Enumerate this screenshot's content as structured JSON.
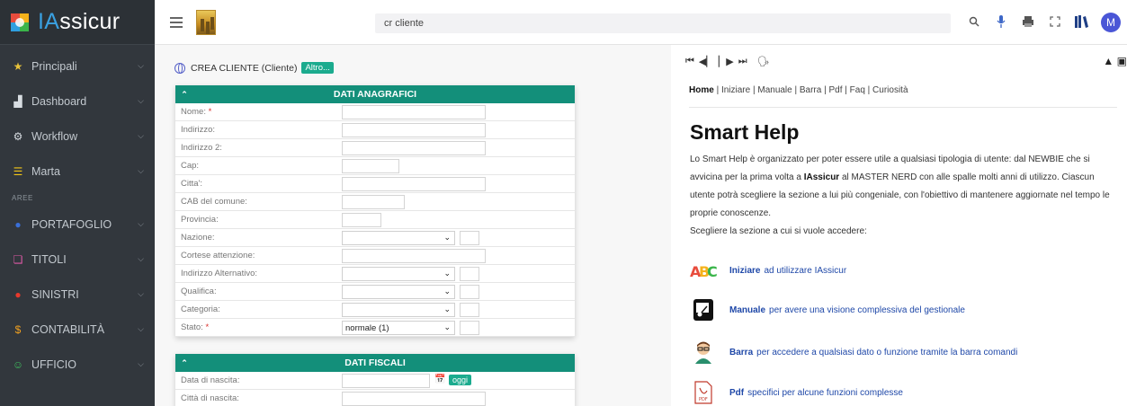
{
  "brand": {
    "name_prefix": "IA",
    "name_rest": "ssicur"
  },
  "sidebar": {
    "items": [
      {
        "label": "Principali",
        "icon": "star-icon",
        "glyph": "★",
        "color": "#e8c23a"
      },
      {
        "label": "Dashboard",
        "icon": "bar-chart-icon",
        "glyph": "▟",
        "color": "#d8dde2"
      },
      {
        "label": "Workflow",
        "icon": "gear-icon",
        "glyph": "⚙",
        "color": "#d8dde2"
      },
      {
        "label": "Marta",
        "icon": "list-icon",
        "glyph": "☰",
        "color": "#f0c419"
      }
    ],
    "section_label": "AREE",
    "area_items": [
      {
        "label": "PORTAFOGLIO",
        "icon": "globe-icon",
        "glyph": "●",
        "color": "#3a6fd8"
      },
      {
        "label": "TITOLI",
        "icon": "documents-icon",
        "glyph": "❏",
        "color": "#e05aa8"
      },
      {
        "label": "SINISTRI",
        "icon": "alert-icon",
        "glyph": "●",
        "color": "#e8392c"
      },
      {
        "label": "CONTABILITÀ",
        "icon": "dollar-icon",
        "glyph": "$",
        "color": "#f0a020"
      },
      {
        "label": "UFFICIO",
        "icon": "smile-icon",
        "glyph": "☺",
        "color": "#3fbf5f"
      }
    ]
  },
  "topbar": {
    "search_value": "cr cliente",
    "icons": [
      "search-icon",
      "microphone-icon",
      "print-icon",
      "fullscreen-icon",
      "book-icon"
    ],
    "avatar_initial": "M"
  },
  "form": {
    "breadcrumb": "CREA CLIENTE (Cliente)",
    "altro_label": "Altro...",
    "anagrafici": {
      "title": "DATI ANAGRAFICI",
      "rows": [
        {
          "label": "Nome:",
          "required": "*",
          "type": "input",
          "w": 160
        },
        {
          "label": "Indirizzo:",
          "required": "",
          "type": "input",
          "w": 160
        },
        {
          "label": "Indirizzo 2:",
          "required": "",
          "type": "input",
          "w": 160
        },
        {
          "label": "Cap:",
          "required": "",
          "type": "input",
          "w": 64
        },
        {
          "label": "Citta':",
          "required": "",
          "type": "input",
          "w": 160
        },
        {
          "label": "CAB del comune:",
          "required": "",
          "type": "input",
          "w": 70
        },
        {
          "label": "Provincia:",
          "required": "",
          "type": "input",
          "w": 44
        },
        {
          "label": "Nazione:",
          "required": "",
          "type": "select",
          "value": ""
        },
        {
          "label": "Cortese attenzione:",
          "required": "",
          "type": "input",
          "w": 160
        },
        {
          "label": "Indirizzo Alternativo:",
          "required": "",
          "type": "select",
          "value": ""
        },
        {
          "label": "Qualifica:",
          "required": "",
          "type": "select",
          "value": ""
        },
        {
          "label": "Categoria:",
          "required": "",
          "type": "select",
          "value": ""
        },
        {
          "label": "Stato:",
          "required": "*",
          "type": "select",
          "value": "normale (1)"
        }
      ]
    },
    "fiscali": {
      "title": "DATI FISCALI",
      "rows": [
        {
          "label": "Data di nascita:",
          "required": "",
          "type": "date",
          "oggi": "oggi"
        },
        {
          "label": "Città di nascita:",
          "required": "",
          "type": "input",
          "w": 160
        }
      ]
    }
  },
  "help": {
    "nav": [
      "Home",
      "Iniziare",
      "Manuale",
      "Barra",
      "Pdf",
      "Faq",
      "Curiosità"
    ],
    "title": "Smart Help",
    "body_1": "Lo Smart Help è organizzato per poter essere utile a qualsiasi tipologia di utente: dal NEWBIE che si avvicina per la prima volta a ",
    "body_brand": "IAssicur",
    "body_2": " al MASTER NERD con alle spalle molti anni di utilizzo. Ciascun utente potrà scegliere la sezione a lui più congeniale, con l'obiettivo di mantenere aggiornate nel tempo le proprie conoscenze.",
    "body_3": "Scegliere la sezione a cui si vuole accedere:",
    "items": [
      {
        "link": "Iniziare",
        "rest": "ad utilizzare IAssicur",
        "icon": "abc-icon"
      },
      {
        "link": "Manuale",
        "rest": "per avere una visione complessiva del gestionale",
        "icon": "teacher-board-icon"
      },
      {
        "link": "Barra",
        "rest": "per accedere a qualsiasi dato o funzione tramite la barra comandi",
        "icon": "nerd-avatar-icon"
      },
      {
        "link": "Pdf",
        "rest": "specifici per alcune funzioni complesse",
        "icon": "pdf-icon"
      }
    ]
  }
}
